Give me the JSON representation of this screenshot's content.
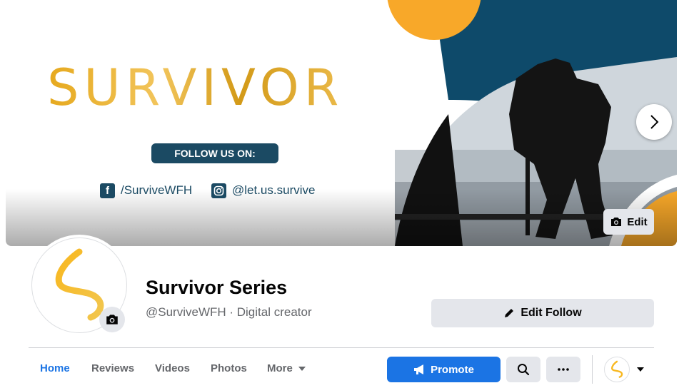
{
  "cover": {
    "title": "SURVIVOR",
    "follow_label": "FOLLOW US ON:",
    "facebook_glyph": "f",
    "facebook_handle": "/SurviveWFH",
    "instagram_handle": "@let.us.survive",
    "edit_label": "Edit",
    "next_icon": "chevron-right-icon",
    "colors": {
      "gold": "#e6a91e",
      "navy": "#1b4a63",
      "orange": "#f8a829",
      "deep_blue": "#0e4a6a"
    }
  },
  "profile": {
    "name": "Survivor Series",
    "subtitle": "@SurviveWFH · Digital creator",
    "edit_follow_label": "Edit Follow",
    "camera_icon": "camera-icon"
  },
  "tabs": [
    {
      "label": "Home",
      "active": true
    },
    {
      "label": "Reviews",
      "active": false
    },
    {
      "label": "Videos",
      "active": false
    },
    {
      "label": "Photos",
      "active": false
    },
    {
      "label": "More",
      "active": false
    }
  ],
  "actions": {
    "promote_label": "Promote",
    "search_icon": "search-icon",
    "more_icon": "more-dots-icon",
    "accent": "#1b74e4"
  }
}
